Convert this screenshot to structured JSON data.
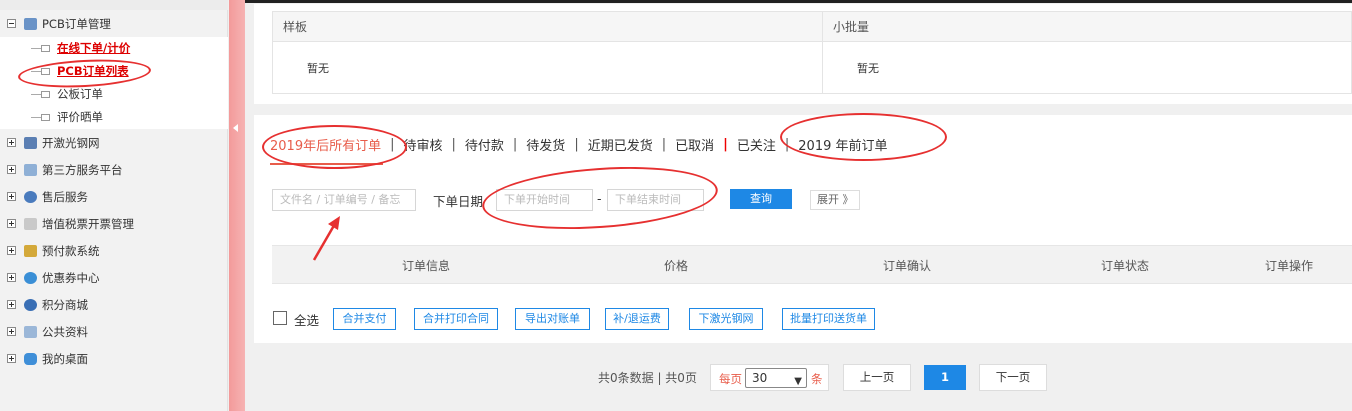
{
  "sidebar": {
    "groups": [
      {
        "label": "PCB订单管理",
        "icon": "pcb-order-icon",
        "expanded": true
      },
      {
        "label": "开激光钢网",
        "icon": "laser-stencil-icon"
      },
      {
        "label": "第三方服务平台",
        "icon": "third-party-icon"
      },
      {
        "label": "售后服务",
        "icon": "after-sales-icon"
      },
      {
        "label": "增值税票开票管理",
        "icon": "invoice-icon"
      },
      {
        "label": "预付款系统",
        "icon": "prepay-icon"
      },
      {
        "label": "优惠券中心",
        "icon": "coupon-icon"
      },
      {
        "label": "积分商城",
        "icon": "points-icon"
      },
      {
        "label": "公共资料",
        "icon": "public-docs-icon"
      },
      {
        "label": "我的桌面",
        "icon": "desktop-icon"
      }
    ],
    "pcb_items": [
      {
        "label": "在线下单/计价",
        "style": "highlight"
      },
      {
        "label": "PCB订单列表",
        "style": "highlight"
      },
      {
        "label": "公板订单",
        "style": "normal"
      },
      {
        "label": "评价晒单",
        "style": "normal"
      }
    ]
  },
  "top_panel": {
    "left_header": "样板",
    "left_body": "暂无",
    "right_header": "小批量",
    "right_body": "暂无"
  },
  "tabs": [
    "2019年后所有订单",
    "待审核",
    "待付款",
    "待发货",
    "近期已发货",
    "已取消",
    "已关注",
    "2019 年前订单"
  ],
  "filter": {
    "search_placeholder": "文件名 / 订单编号 / 备忘",
    "date_label": "下单日期",
    "start_placeholder": "下单开始时间",
    "end_placeholder": "下单结束时间",
    "date_sep": "-",
    "query_button": "查询",
    "expand_button": "展开 》"
  },
  "table_headers": [
    "订单信息",
    "价格",
    "订单确认",
    "订单状态",
    "订单操作"
  ],
  "actions": {
    "select_all": "全选",
    "buttons": [
      "合并支付",
      "合并打印合同",
      "导出对账单",
      "补/退运费",
      "下激光钢网",
      "批量打印送货单"
    ]
  },
  "pagination": {
    "info": "共0条数据 | 共0页",
    "per_page_prefix": "每页",
    "per_page_value": "30",
    "per_page_suffix": "条",
    "prev": "上一页",
    "current": "1",
    "next": "下一页"
  },
  "colors": {
    "accent": "#1e88e5",
    "active_tab": "#e85c4a",
    "annotation": "#e63030",
    "sidebar_highlight": "#dd0000"
  }
}
